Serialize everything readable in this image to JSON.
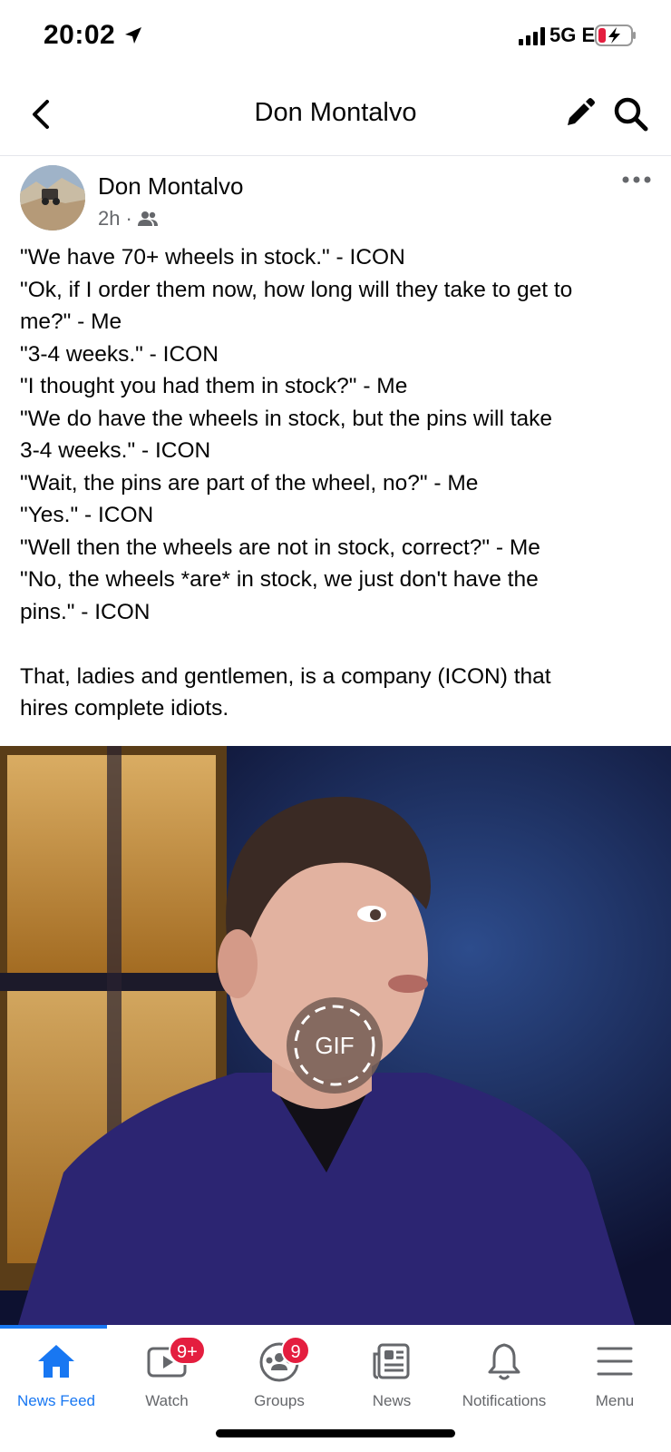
{
  "status_bar": {
    "time": "20:02",
    "network": "5G E",
    "icons": [
      "location-arrow-icon",
      "signal-icon",
      "battery-charging-icon"
    ]
  },
  "header": {
    "title": "Don Montalvo",
    "icons": [
      "back-icon",
      "pencil-icon",
      "search-icon"
    ]
  },
  "post": {
    "author": "Don Montalvo",
    "time": "2h",
    "separator": "·",
    "audience_icon": "friends-icon",
    "lines": [
      "\"We have 70+ wheels in stock.\" - ICON",
      "\"Ok, if I order them now, how long will they take to get to",
      "me?\" - Me",
      "\"3-4 weeks.\" - ICON",
      "\"I thought you had them in stock?\" - Me",
      "\"We do have the wheels in stock, but the pins will take",
      "3-4 weeks.\" - ICON",
      "\"Wait, the pins are part of the wheel, no?\" - Me",
      "\"Yes.\" - ICON",
      "\"Well then the wheels are not in stock, correct?\" - Me",
      "\"No, the wheels *are* in stock, we just don't have the",
      "pins.\" - ICON"
    ],
    "closing_lines": [
      "That, ladies and gentlemen, is a company (ICON) that",
      "hires complete idiots."
    ],
    "gif_label": "GIF"
  },
  "bottom_nav": {
    "active": "News Feed",
    "accent_color": "#1877f2",
    "badge_color": "#e41e3f",
    "items": [
      {
        "label": "News Feed",
        "icon": "home-icon"
      },
      {
        "label": "Watch",
        "icon": "video-icon",
        "badge": "9+"
      },
      {
        "label": "Groups",
        "icon": "groups-icon",
        "badge": "9"
      },
      {
        "label": "News",
        "icon": "newspaper-icon"
      },
      {
        "label": "Notifications",
        "icon": "bell-icon"
      },
      {
        "label": "Menu",
        "icon": "menu-icon"
      }
    ]
  }
}
